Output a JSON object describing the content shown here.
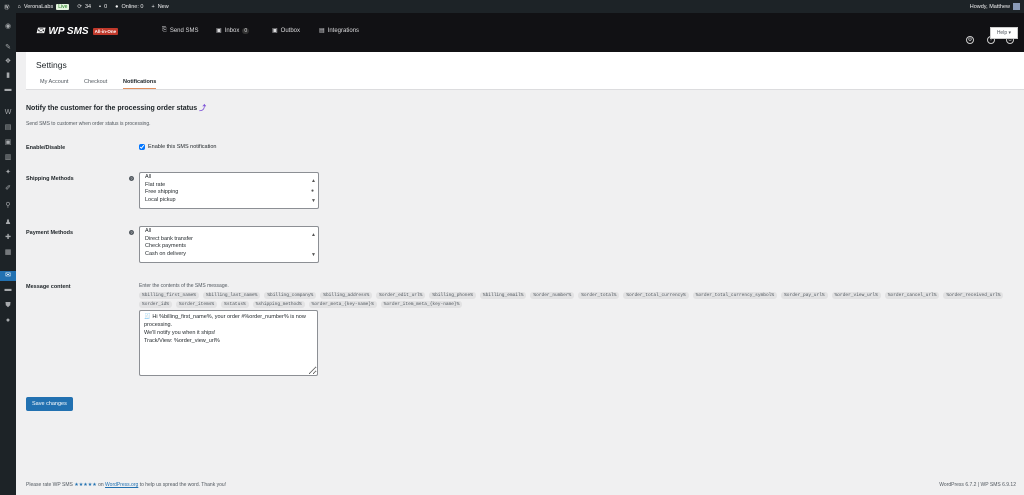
{
  "adminbar": {
    "site": "VeronaLabs",
    "live": "Live",
    "updates": "34",
    "comments": "0",
    "online": "Online: 0",
    "new": "New",
    "howdy": "Howdy, Matthew"
  },
  "sidebar": {
    "icons": [
      "dashboard-icon",
      "pin-icon",
      "media-icon",
      "pages-icon",
      "comments-icon",
      "woo-icon",
      "products-icon",
      "payments-icon",
      "analytics-icon",
      "marketing-icon",
      "appearance-icon",
      "plugins-icon",
      "users-icon",
      "tools-icon",
      "settings-icon",
      "sms-icon",
      "mail-icon",
      "shield-icon",
      "play-icon"
    ],
    "active_index": 15
  },
  "plugin_header": {
    "logo": "WP SMS",
    "edition": "All-in-One",
    "nav": [
      {
        "label": "Send SMS",
        "icon": "send-icon"
      },
      {
        "label": "Inbox",
        "icon": "inbox-icon",
        "badge": "0"
      },
      {
        "label": "Outbox",
        "icon": "outbox-icon"
      },
      {
        "label": "Integrations",
        "icon": "integrations-icon"
      }
    ],
    "help": "Help ▾"
  },
  "settings": {
    "title": "Settings",
    "tabs": [
      "My Account",
      "Checkout",
      "Notifications"
    ],
    "active_tab": "Notifications"
  },
  "section": {
    "title": "Notify the customer for the processing order status",
    "description": "Send SMS to customer when order status is processing."
  },
  "enable": {
    "label": "Enable/Disable",
    "checkbox": "Enable this SMS notification",
    "checked": true
  },
  "shipping": {
    "label": "Shipping Methods",
    "options": [
      "All",
      "Flat rate",
      "Free shipping",
      "Local pickup"
    ]
  },
  "payment": {
    "label": "Payment Methods",
    "options": [
      "All",
      "Direct bank transfer",
      "Check payments",
      "Cash on delivery"
    ]
  },
  "message": {
    "label": "Message content",
    "hint": "Enter the contents of the SMS message.",
    "tags": [
      "%billing_first_name%",
      "%billing_last_name%",
      "%billing_company%",
      "%billing_address%",
      "%order_edit_url%",
      "%billing_phone%",
      "%billing_email%",
      "%order_number%",
      "%order_total%",
      "%order_total_currency%",
      "%order_total_currency_symbol%",
      "%order_pay_url%",
      "%order_view_url%",
      "%order_cancel_url%",
      "%order_received_url%",
      "%order_id%",
      "%order_items%",
      "%status%",
      "%shipping_method%",
      "%order_meta_{key-name}%",
      "%order_item_meta_{key-name}%"
    ],
    "value": "🧾 Hi %billing_first_name%, your order #%order_number% is now processing.\nWe'll notify you when it ships!\nTrack/View: %order_view_url%"
  },
  "save": "Save changes",
  "footer": {
    "pre": "Please rate WP SMS",
    "stars": "★★★★★",
    "on": "on",
    "link": "WordPress.org",
    "post": "to help us spread the word. Thank you!",
    "version": "WordPress 6.7.2 | WP SMS 6.9.12"
  }
}
